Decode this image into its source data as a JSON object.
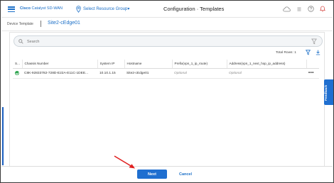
{
  "header": {
    "brand_name": "Cisco",
    "brand_product": "Catalyst SD-WAN",
    "resource_group": "Select Resource Group▾",
    "title": "Configuration · Templates"
  },
  "breadcrumb": {
    "parent": "Device Template",
    "current": "Site2-cEdge01"
  },
  "search": {
    "placeholder": "Search",
    "value": ""
  },
  "table": {
    "total_rows": "Total Rows: 1",
    "columns": [
      "S...",
      "Chassis Number",
      "System IP",
      "Hostname",
      "Prefix(vpn_1_ip_route)",
      "Address(vpn_1_next_hop_ip_address)",
      ""
    ],
    "rows": [
      {
        "status": "ok",
        "chassis": "C8K-92833782-728D-E22A-E11C-1DEE...",
        "system_ip": "10.10.1.15",
        "hostname": "Site2-cEdge01",
        "prefix": "Optional",
        "address": "Optional",
        "actions": "•••"
      }
    ]
  },
  "feedback": {
    "label": "Feedback"
  },
  "footer": {
    "next_label": "Next",
    "cancel_label": "Cancel"
  },
  "icons": {
    "menu": "menu-icon",
    "location": "location-pin-icon",
    "cloud": "cloud-icon",
    "list": "list-icon",
    "help": "help-icon",
    "notification": "bell-icon",
    "search": "search-icon",
    "filter": "filter-icon",
    "download": "download-icon",
    "status": "check-circle-icon"
  },
  "colors": {
    "accent": "#1f6fd0",
    "status_ok": "#2da44e",
    "annotation_arrow": "#e02020"
  }
}
